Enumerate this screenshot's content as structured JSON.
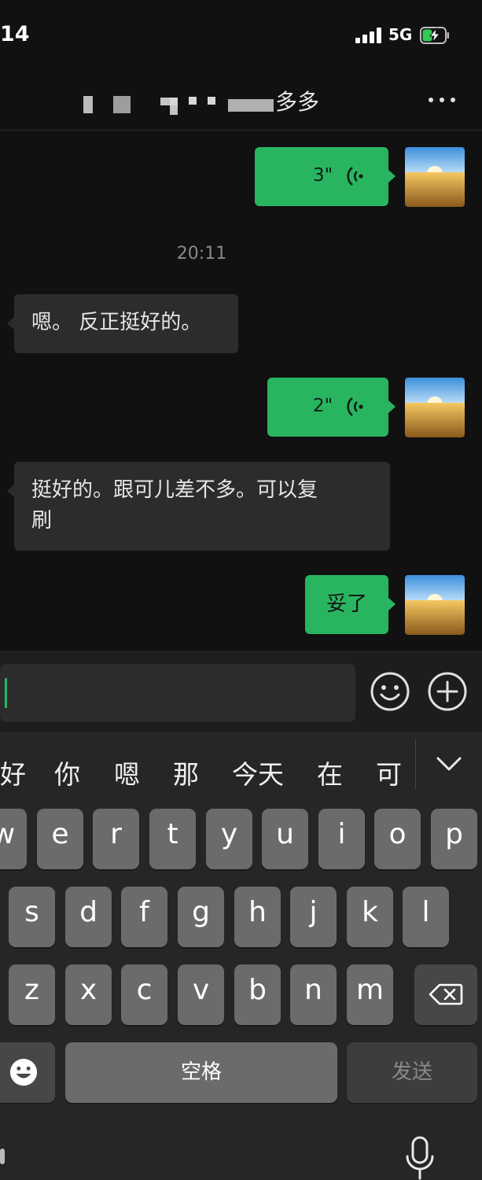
{
  "status_bar": {
    "time": "14",
    "network": "5G",
    "battery_icon": "battery-charging-icon",
    "signal_icon": "cellular-signal-icon"
  },
  "nav": {
    "title": "多多",
    "title_obscured": true,
    "more_icon": "more-dots-icon"
  },
  "messages": [
    {
      "type": "voice",
      "side": "outgoing",
      "duration": "3\""
    },
    {
      "type": "timestamp",
      "text": "20:11"
    },
    {
      "type": "text",
      "side": "incoming",
      "text": "嗯。 反正挺好的。"
    },
    {
      "type": "voice",
      "side": "outgoing",
      "duration": "2\""
    },
    {
      "type": "text",
      "side": "incoming",
      "lines": [
        "挺好的。跟可儿差不多。可以复",
        "刷"
      ]
    },
    {
      "type": "text",
      "side": "outgoing",
      "text": "妥了"
    }
  ],
  "input": {
    "value": "",
    "emoji_icon": "emoji-icon",
    "plus_icon": "plus-circle-icon"
  },
  "suggestions": [
    "好",
    "你",
    "嗯",
    "那",
    "今天",
    "在",
    "可"
  ],
  "keyboard": {
    "row1": [
      "w",
      "e",
      "r",
      "t",
      "y",
      "u",
      "i",
      "o",
      "p"
    ],
    "row2": [
      "s",
      "d",
      "f",
      "g",
      "h",
      "j",
      "k",
      "l"
    ],
    "row3": [
      "z",
      "x",
      "c",
      "v",
      "b",
      "n",
      "m"
    ],
    "space_label": "空格",
    "send_label": "发送"
  },
  "colors": {
    "accent_green": "#29b560",
    "background": "#111111",
    "incoming_bubble": "#2c2c2c"
  }
}
